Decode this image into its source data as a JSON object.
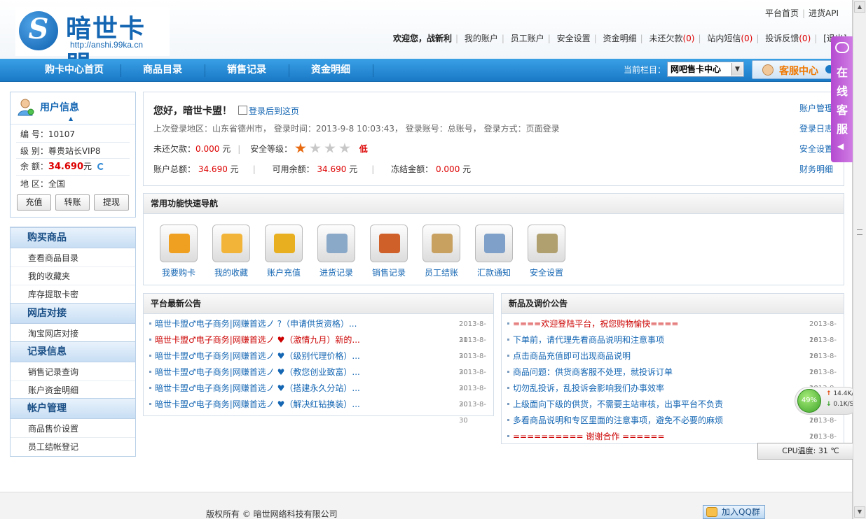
{
  "header": {
    "logo_name": "暗世卡盟",
    "logo_url": "http://anshi.99ka.cn",
    "logo_glyph": "S",
    "top_links": [
      "平台首页",
      "进货API"
    ],
    "welcome": "欢迎您，战新利",
    "nav": [
      {
        "label": "我的账户"
      },
      {
        "label": "员工账户"
      },
      {
        "label": "安全设置"
      },
      {
        "label": "资金明细"
      },
      {
        "label": "未还欠款",
        "count": "(0)"
      },
      {
        "label": "站内短信",
        "count": "(0)"
      },
      {
        "label": "投诉反馈",
        "count": "(0)"
      },
      {
        "label": "[退出]"
      }
    ]
  },
  "menubar": {
    "items": [
      "购卡中心首页",
      "商品目录",
      "销售记录",
      "资金明细"
    ],
    "current_label": "当前栏目：",
    "current_value": "网吧售卡中心",
    "kefu_label": "客服中心"
  },
  "user_info": {
    "title": "用户信息",
    "id_label": "编 号：",
    "id_value": "10107",
    "level_label": "级 别：",
    "level_value": "尊贵站长VIP8",
    "balance_label": "余 额：",
    "balance_value": "34.690",
    "balance_unit": "元",
    "region_label": "地 区：",
    "region_value": "全国",
    "buttons": [
      "充值",
      "转账",
      "提现"
    ]
  },
  "left_nav": [
    {
      "title": "购买商品",
      "items": [
        "查看商品目录",
        "我的收藏夹",
        "库存提取卡密"
      ]
    },
    {
      "title": "网店对接",
      "items": [
        "淘宝网店对接"
      ]
    },
    {
      "title": "记录信息",
      "items": [
        "销售记录查询",
        "账户资金明细"
      ]
    },
    {
      "title": "帐户管理",
      "items": [
        "商品售价设置",
        "员工结帐登记"
      ]
    }
  ],
  "welcome_panel": {
    "hello": "您好，暗世卡盟！",
    "checkbox_label": "登录后到这页",
    "login_info": "上次登录地区：山东省德州市， 登录时间：2013-9-8 10:03:43， 登录账号：总账号， 登录方式：页面登录",
    "debt_label": "未还欠款：",
    "debt_value": "0.000",
    "unit": "元",
    "security_label": "安全等级：",
    "security_stars": 1,
    "security_max": 4,
    "security_text": "低",
    "total_label": "账户总额：",
    "total_value": "34.690",
    "available_label": "可用余额：",
    "available_value": "34.690",
    "frozen_label": "冻结金额：",
    "frozen_value": "0.000",
    "right_links": [
      "账户管理",
      "登录日志",
      "安全设置",
      "财务明细"
    ]
  },
  "quick_nav": {
    "title": "常用功能快速导航",
    "items": [
      {
        "label": "我要购卡",
        "icon": "cart-icon",
        "color": "#f0a020"
      },
      {
        "label": "我的收藏",
        "icon": "star-icon",
        "color": "#f2b53a"
      },
      {
        "label": "账户充值",
        "icon": "coins-icon",
        "color": "#e8b020"
      },
      {
        "label": "进货记录",
        "icon": "magnifier-icon",
        "color": "#8aa8c8"
      },
      {
        "label": "销售记录",
        "icon": "bar-chart-icon",
        "color": "#d0602a"
      },
      {
        "label": "员工结账",
        "icon": "clipboard-icon",
        "color": "#c8a060"
      },
      {
        "label": "汇款通知",
        "icon": "document-icon",
        "color": "#7fa0c8"
      },
      {
        "label": "安全设置",
        "icon": "lock-icon",
        "color": "#b0a070"
      }
    ]
  },
  "platform_notices": {
    "title": "平台最新公告",
    "items": [
      {
        "text": "暗世卡盟♂电子商务|网赚首选ノ ?（申请供货资格）...",
        "date": "2013-8-31",
        "red": false
      },
      {
        "text": "暗世卡盟♂电子商务|网赚首选ノ ♥（激情九月）新的...",
        "date": "2013-8-30",
        "red": true
      },
      {
        "text": "暗世卡盟♂电子商务|网赚首选ノ ♥（级别代理价格）...",
        "date": "2013-8-30",
        "red": false
      },
      {
        "text": "暗世卡盟♂电子商务|网赚首选ノ ♥（教您创业致富）...",
        "date": "2013-8-30",
        "red": false
      },
      {
        "text": "暗世卡盟♂电子商务|网赚首选ノ ♥（搭建永久分站）...",
        "date": "2013-8-30",
        "red": false
      },
      {
        "text": "暗世卡盟♂电子商务|网赚首选ノ ♥（解决红钻换装）...",
        "date": "2013-8-30",
        "red": false
      }
    ]
  },
  "price_notices": {
    "title": "新品及调价公告",
    "items": [
      {
        "text": "====欢迎登陆平台，祝您购物愉快====",
        "date": "2013-8-18",
        "red": true
      },
      {
        "text": "下单前，请代理先看商品说明和注意事项",
        "date": "2013-8-18",
        "red": false
      },
      {
        "text": "点击商品充值即可出现商品说明",
        "date": "2013-8-18",
        "red": false
      },
      {
        "text": "商品问题：供货商客服不处理，就投诉订单",
        "date": "2013-8-18",
        "red": false
      },
      {
        "text": "切勿乱投诉，乱投诉会影响我们办事效率",
        "date": "2013-8-18",
        "red": false
      },
      {
        "text": "上级面向下级的供货，不需要主站审核，出事平台不负责",
        "date": "2013-8-18",
        "red": false
      },
      {
        "text": "多看商品说明和专区里面的注意事项，避免不必要的麻烦",
        "date": "2013-8-18",
        "red": false
      },
      {
        "text": "========== 谢谢合作 ======",
        "date": "2013-8-18",
        "red": true
      }
    ]
  },
  "online_service": {
    "text": "在线客服",
    "chars": [
      "在",
      "线",
      "客",
      "服"
    ],
    "arrow": "◀"
  },
  "network_widget": {
    "percent": "49%",
    "up": "14.4K/S",
    "down": "0.1K/S"
  },
  "cpu_widget": {
    "text": "CPU温度: 31 ℃"
  },
  "footer": {
    "copyright": "版权所有 © 暗世网络科技有限公司",
    "qq_button": "加入QQ群"
  }
}
